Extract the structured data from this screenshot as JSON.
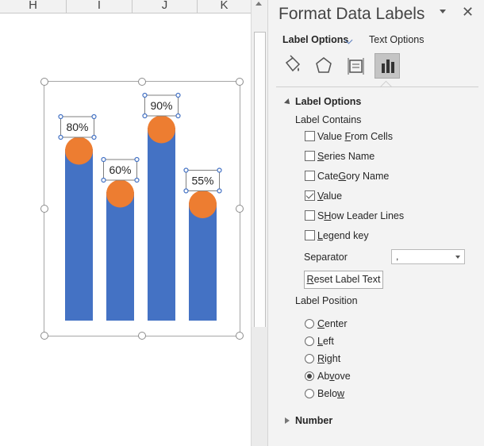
{
  "sheet": {
    "columns": [
      "H",
      "I",
      "J",
      "K"
    ]
  },
  "chart_data": {
    "type": "bar",
    "categories": [
      "",
      "",
      "",
      ""
    ],
    "values": [
      80,
      60,
      90,
      55
    ],
    "labels": [
      "80%",
      "60%",
      "90%",
      "55%"
    ],
    "ylim": [
      0,
      100
    ],
    "colors": {
      "bar": "#4472c4",
      "marker": "#ed7d31"
    },
    "title": "",
    "xlabel": "",
    "ylabel": ""
  },
  "pane": {
    "title": "Format Data Labels",
    "tabs": {
      "label_options": "Label Options",
      "text_options": "Text Options"
    },
    "icons": [
      "fill-line-icon",
      "effects-icon",
      "size-properties-icon",
      "label-options-icon"
    ],
    "label_options_section": "Label Options",
    "label_contains": "Label Contains",
    "checkboxes": [
      {
        "label": "Value From Cells",
        "checked": false,
        "key": "F",
        "pre": "Value ",
        "post": "rom Cells"
      },
      {
        "label": "Series Name",
        "checked": false,
        "key": "S",
        "pre": "",
        "post": "eries Name"
      },
      {
        "label": "Category Name",
        "checked": false,
        "key": "G",
        "pre": "Cate",
        "post": "ory Name"
      },
      {
        "label": "Value",
        "checked": true,
        "key": "V",
        "pre": "",
        "post": "alue"
      },
      {
        "label": "Show Leader Lines",
        "checked": false,
        "key": "H",
        "pre": "S",
        "post": "ow Leader Lines"
      },
      {
        "label": "Legend key",
        "checked": false,
        "key": "L",
        "pre": "",
        "post": "egend key"
      }
    ],
    "separator_label": "Separator",
    "separator_value": ",",
    "reset_button": "Reset Label Text",
    "label_position": "Label Position",
    "positions": [
      {
        "label": "Center",
        "selected": false,
        "key": "C",
        "pre": "",
        "post": "enter"
      },
      {
        "label": "Left",
        "selected": false,
        "key": "L",
        "pre": "",
        "post": "eft"
      },
      {
        "label": "Right",
        "selected": false,
        "key": "R",
        "pre": "",
        "post": "ight"
      },
      {
        "label": "Above",
        "selected": true,
        "key": "v",
        "pre": "Ab",
        "post": "ove"
      },
      {
        "label": "Below",
        "selected": false,
        "key": "w",
        "pre": "Belo",
        "post": ""
      }
    ],
    "number_section": "Number"
  }
}
